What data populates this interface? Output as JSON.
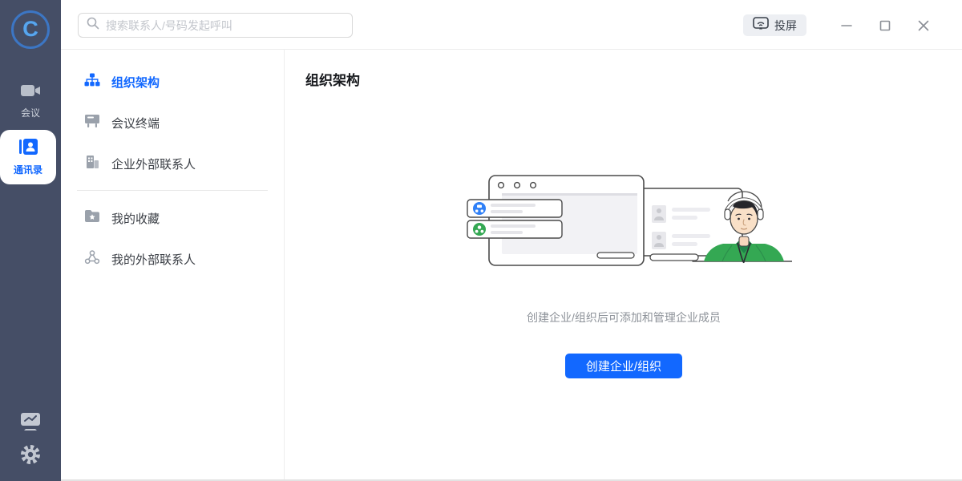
{
  "window": {
    "cast_label": "投屏"
  },
  "search": {
    "placeholder": "搜索联系人/号码发起呼叫"
  },
  "rail": {
    "meeting_label": "会议",
    "contacts_label": "通讯录"
  },
  "sidebar": {
    "groups": [
      {
        "items": [
          {
            "label": "组织架构"
          },
          {
            "label": "会议终端"
          },
          {
            "label": "企业外部联系人"
          }
        ]
      },
      {
        "items": [
          {
            "label": "我的收藏"
          },
          {
            "label": "我的外部联系人"
          }
        ]
      }
    ]
  },
  "main": {
    "title": "组织架构",
    "empty_state": {
      "caption": "创建企业/组织后可添加和管理企业成员",
      "button_label": "创建企业/组织"
    }
  },
  "colors": {
    "accent": "#1268ff",
    "rail_bg": "#454e66",
    "illustration_green": "#34a853",
    "illustration_blue": "#2f80f7"
  }
}
